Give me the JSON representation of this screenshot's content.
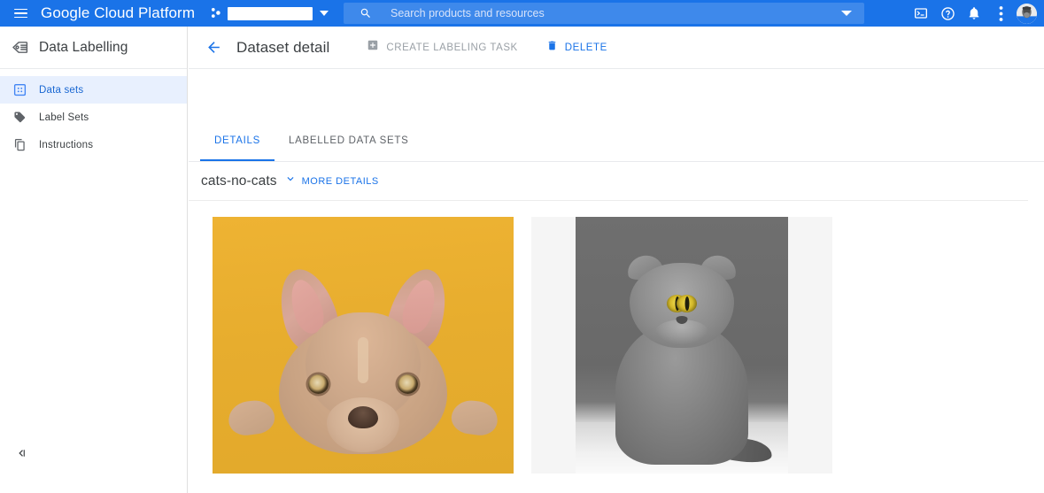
{
  "topbar": {
    "menu_icon": "hamburger-icon",
    "brand": "Google Cloud Platform",
    "project_icon": "cloud-project-icon",
    "project_name": "",
    "project_caret_icon": "caret-down-icon",
    "search": {
      "icon": "search-icon",
      "placeholder": "Search products and resources",
      "value": "",
      "caret_icon": "chevron-down-icon"
    },
    "actions": [
      {
        "name": "cloud-shell-icon",
        "label": "Activate Cloud Shell"
      },
      {
        "name": "help-icon",
        "label": "Help"
      },
      {
        "name": "notifications-bell-icon",
        "label": "Notifications"
      },
      {
        "name": "more-vert-icon",
        "label": "More options"
      }
    ],
    "avatar_label": "Account",
    "brand_color": "#1a73e8"
  },
  "sidebar": {
    "product_icon": "data-labelling-icon",
    "title": "Data Labelling",
    "items": [
      {
        "icon": "data-sets-icon",
        "label": "Data sets",
        "selected": true
      },
      {
        "icon": "label-sets-icon",
        "label": "Label Sets",
        "selected": false
      },
      {
        "icon": "instructions-icon",
        "label": "Instructions",
        "selected": false
      }
    ],
    "collapse_icon": "collapse-panel-icon",
    "selected_bg": "#e8f0fe",
    "selected_fg": "#1967d2"
  },
  "content": {
    "back_icon": "back-arrow-icon",
    "page_title": "Dataset detail",
    "actions": [
      {
        "icon": "add-box-icon",
        "label": "CREATE LABELING TASK",
        "state": "disabled"
      },
      {
        "icon": "delete-icon",
        "label": "DELETE",
        "state": "enabled"
      }
    ],
    "tabs": [
      {
        "label": "DETAILS",
        "active": true
      },
      {
        "label": "LABELLED DATA SETS",
        "active": false
      }
    ],
    "dataset": {
      "name": "cats-no-cats",
      "expand_icon": "chevron-down-icon",
      "more_details_label": "MORE DETAILS"
    },
    "images": [
      {
        "name": "dataset-image-dog",
        "alt": "French bulldog puppy lying on yellow background"
      },
      {
        "name": "dataset-image-cat",
        "alt": "Grey Scottish Fold cat sitting, black and white photo"
      }
    ]
  }
}
